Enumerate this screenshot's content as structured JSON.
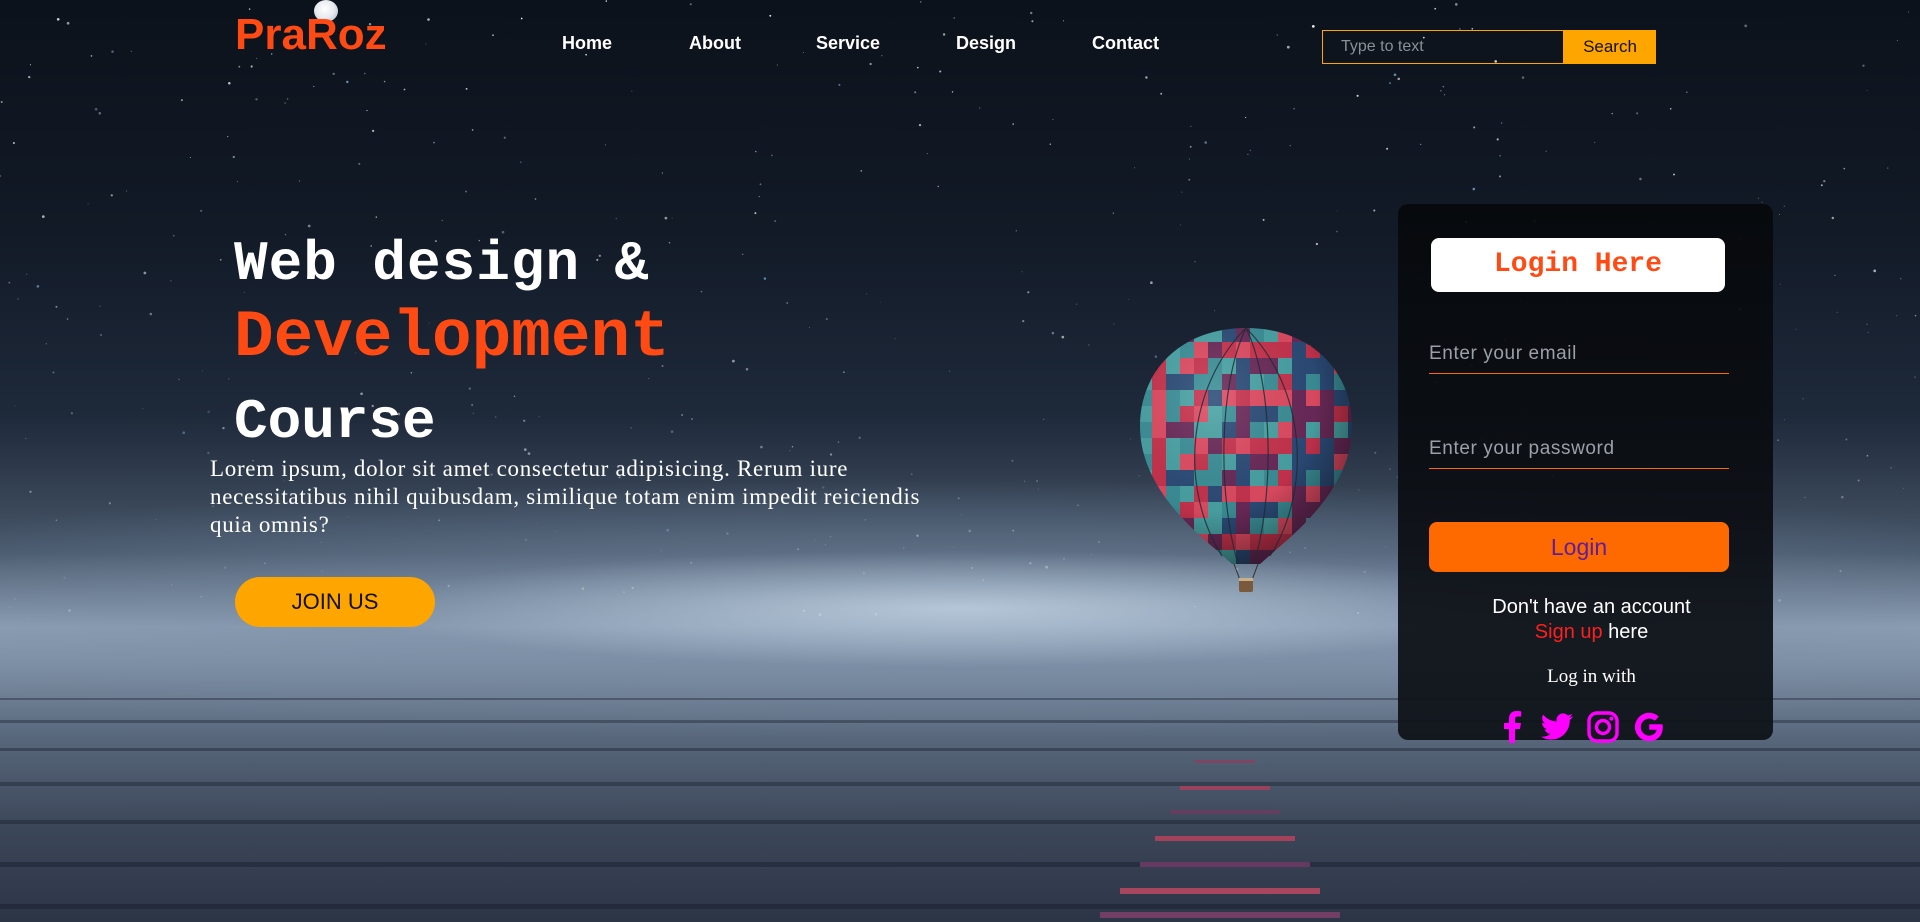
{
  "header": {
    "logo": "PraRoz",
    "nav": [
      "Home",
      "About",
      "Service",
      "Design",
      "Contact"
    ],
    "search": {
      "placeholder": "Type to text",
      "button_label": "Search"
    }
  },
  "hero": {
    "line1": "Web design &",
    "line2": "Development",
    "line3": "Course",
    "paragraph": "Lorem ipsum, dolor sit amet consectetur adipisicing. Rerum iure necessitatibus nihil quibusdam, similique totam enim impedit reiciendis quia omnis?",
    "join_label": "JOIN US"
  },
  "login": {
    "title": "Login Here",
    "email_placeholder": "Enter your email",
    "password_placeholder": "Enter your password",
    "button_label": "Login",
    "no_account": "Don't have an account",
    "signup_link": "Sign up",
    "signup_suffix": " here",
    "login_with": "Log in with",
    "socials": [
      "facebook-icon",
      "twitter-icon",
      "instagram-icon",
      "google-icon"
    ],
    "social_color": "#ff00ff"
  },
  "colors": {
    "accent": "#ff4a14",
    "button_orange": "#ffa500",
    "login_orange": "#ff6a00"
  }
}
